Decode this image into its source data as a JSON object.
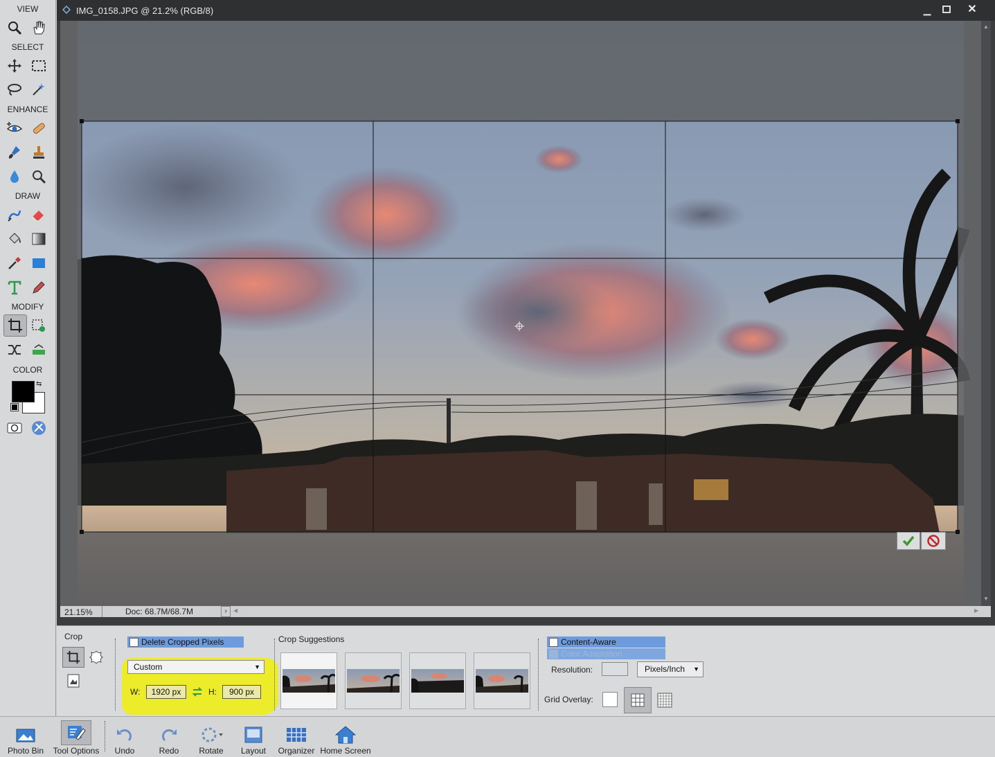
{
  "toolbox": {
    "view_label": "VIEW",
    "select_label": "SELECT",
    "enhance_label": "ENHANCE",
    "draw_label": "DRAW",
    "modify_label": "MODIFY",
    "color_label": "COLOR"
  },
  "document": {
    "title": "IMG_0158.JPG @ 21.2% (RGB/8)",
    "zoom": "21.15%",
    "doc_size": "Doc: 68.7M/68.7M"
  },
  "options": {
    "panel_label": "Crop",
    "delete_cropped_label": "Delete Cropped Pixels",
    "preset_value": "Custom",
    "width_label": "W:",
    "width_value": "1920 px",
    "height_label": "H:",
    "height_value": "900 px",
    "suggestions_label": "Crop Suggestions",
    "content_aware_label": "Content-Aware",
    "color_adaptation_label": "Color Adaptation",
    "resolution_label": "Resolution:",
    "resolution_value": "",
    "resolution_unit": "Pixels/Inch",
    "grid_overlay_label": "Grid Overlay:"
  },
  "taskbar": {
    "photo_bin": "Photo Bin",
    "tool_options": "Tool Options",
    "undo": "Undo",
    "redo": "Redo",
    "rotate": "Rotate",
    "layout": "Layout",
    "organizer": "Organizer",
    "home_screen": "Home Screen"
  },
  "colors": {
    "highlight": "#ecec2a",
    "accent_blue": "#6e9bdc",
    "commit_green": "#3a9a2a",
    "cancel_red": "#c0282c"
  }
}
